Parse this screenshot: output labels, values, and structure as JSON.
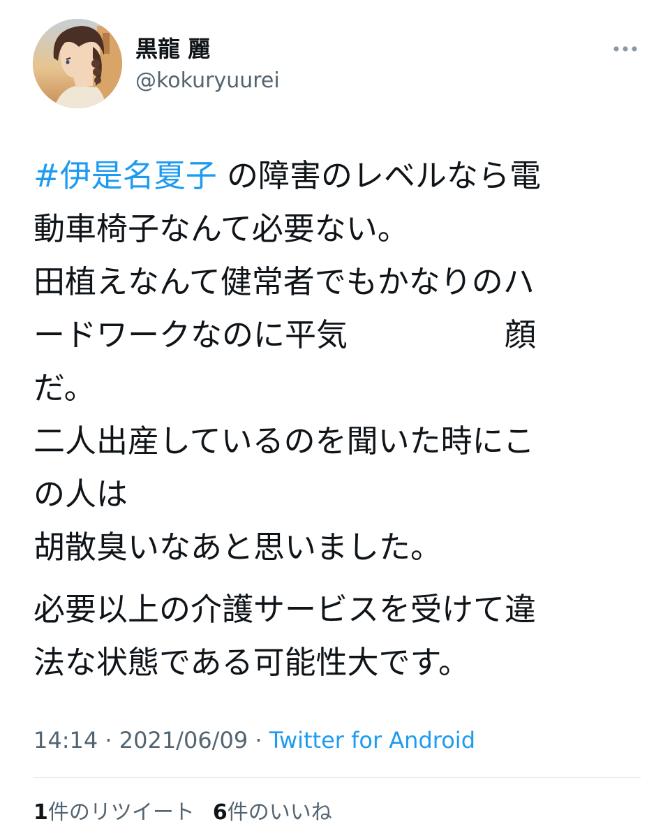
{
  "author": {
    "display_name": "黒龍 麗",
    "handle": "@kokuryuurei",
    "avatar_icon": "anime-girl-avatar"
  },
  "more_icon": "more-horizontal-icon",
  "tweet": {
    "hashtag": "#伊是名夏子",
    "lines": [
      " の障害のレベルなら電",
      "動車椅子なんて必要ない。",
      "田植えなんて健常者でもかなりのハ",
      "ードワークなのに平気　　　　　顔",
      "だ。",
      "二人出産しているのを聞いた時にこ",
      "の人は",
      "胡散臭いなあと思いました。"
    ],
    "paragraph2": [
      "必要以上の介護サービスを受けて違",
      "法な状態である可能性大です。"
    ]
  },
  "meta": {
    "time": "14:14",
    "separator": " · ",
    "date": "2021/06/09",
    "source": "Twitter for Android"
  },
  "stats": {
    "retweet_count": "1",
    "retweet_label": "件のリツイート",
    "like_count": "6",
    "like_label": "件のいいね"
  },
  "colors": {
    "link": "#1d9bf0",
    "secondary": "#536471",
    "text": "#0f1419"
  }
}
